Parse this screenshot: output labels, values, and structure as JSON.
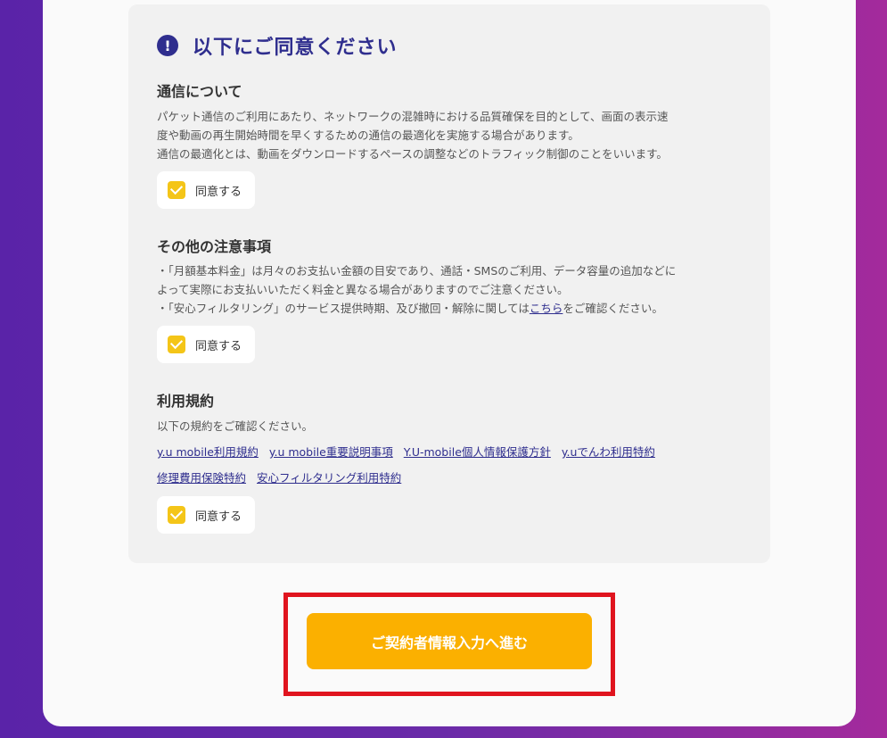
{
  "agreement": {
    "title": "以下にご同意ください",
    "sections": [
      {
        "heading": "通信について",
        "lines": [
          "パケット通信のご利用にあたり、ネットワークの混雑時における品質確保を目的として、画面の表示速",
          "度や動画の再生開始時間を早くするための通信の最適化を実施する場合があります。",
          "通信の最適化とは、動画をダウンロードするペースの調整などのトラフィック制御のことをいいます。"
        ],
        "checkbox_label": "同意する"
      },
      {
        "heading": "その他の注意事項",
        "lines": [
          "・「月額基本料金」は月々のお支払い金額の目安であり、通話・SMSのご利用、データ容量の追加などに",
          "よって実際にお支払いいただく料金と異なる場合がありますのでご注意ください。"
        ],
        "line3_prefix": "・「安心フィルタリング」のサービス提供時期、及び撤回・解除に関しては",
        "line3_link": "こちら",
        "line3_suffix": "をご確認ください。",
        "checkbox_label": "同意する"
      },
      {
        "heading": "利用規約",
        "intro": "以下の規約をご確認ください。",
        "links": [
          "y.u mobile利用規約",
          "y.u mobile重要説明事項",
          "Y.U-mobile個人情報保護方針",
          "y.uでんわ利用特約",
          "修理費用保険特約",
          "安心フィルタリング利用特約"
        ],
        "checkbox_label": "同意する"
      }
    ]
  },
  "cta": {
    "label": "ご契約者情報入力へ進む"
  },
  "colors": {
    "accent": "#2f2e8e",
    "checkbox": "#f4c518",
    "cta": "#fbb000",
    "highlight": "#e0141e"
  }
}
